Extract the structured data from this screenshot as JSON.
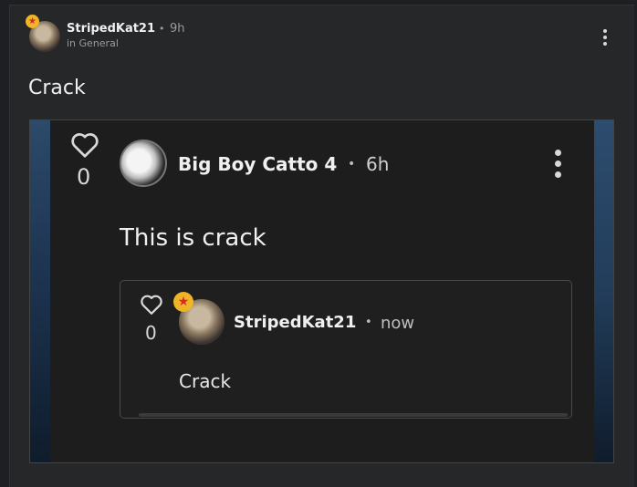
{
  "post": {
    "author": "StripedKat21",
    "separator": "•",
    "time": "9h",
    "community": "in General",
    "title": "Crack"
  },
  "embed": {
    "likes": "0",
    "author": "Big Boy Catto 4",
    "separator": "•",
    "time": "6h",
    "body": "This is crack",
    "reply": {
      "likes": "0",
      "author": "StripedKat21",
      "separator": "•",
      "time": "now",
      "body": "Crack"
    }
  },
  "icons": {
    "menu": "more-vertical-icon",
    "like": "heart-outline-icon",
    "badge": "star-badge-icon"
  },
  "colors": {
    "badge": "#f0b429",
    "badge_star": "#d62828",
    "background": "#262729"
  }
}
